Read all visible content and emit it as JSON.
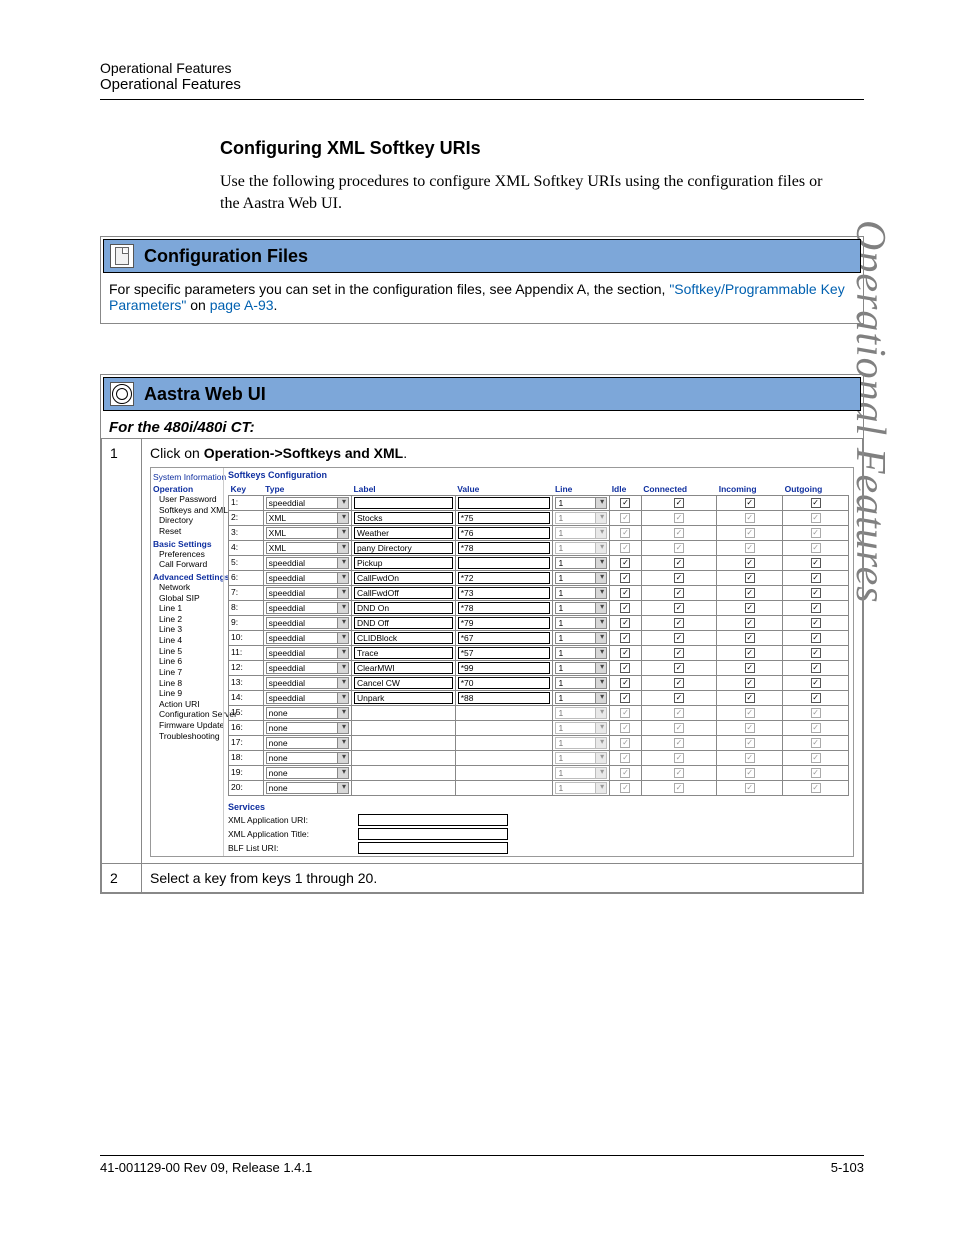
{
  "header": {
    "line1": "Operational Features",
    "line2": "Operational Features"
  },
  "vertical_tab": "Operational Features",
  "section_heading": "Configuring XML Softkey URIs",
  "intro_para": "Use the following procedures to configure XML Softkey URIs using the configuration files or the Aastra Web UI.",
  "config_panel": {
    "title": "Configuration Files",
    "body_prefix": "For specific parameters you can set in the configuration files, see Appendix A, the section, ",
    "link_text": "\"Softkey/Programmable Key Parameters\"",
    "body_mid": " on ",
    "page_ref": "page A-93",
    "body_suffix": "."
  },
  "web_panel": {
    "title": "Aastra Web UI",
    "subtitle": "For the 480i/480i CT:",
    "steps": [
      {
        "num": "1",
        "text_prefix": "Click on ",
        "text_bold": "Operation->Softkeys and XML",
        "text_suffix": "."
      },
      {
        "num": "2",
        "text": "Select a key from keys 1 through 20."
      }
    ]
  },
  "ui": {
    "nav": [
      {
        "cat": "",
        "items": [
          "System Information"
        ]
      },
      {
        "cat": "Operation",
        "items": [
          "User Password",
          "Softkeys and XML",
          "Directory",
          "Reset"
        ]
      },
      {
        "cat": "Basic Settings",
        "items": [
          "Preferences",
          "Call Forward"
        ]
      },
      {
        "cat": "Advanced Settings",
        "items": [
          "Network",
          "Global SIP",
          "Line 1",
          "Line 2",
          "Line 3",
          "Line 4",
          "Line 5",
          "Line 6",
          "Line 7",
          "Line 8",
          "Line 9",
          "Action URI",
          "Configuration Server",
          "Firmware Update",
          "Troubleshooting"
        ]
      }
    ],
    "main_title": "Softkeys Configuration",
    "columns": [
      "Key",
      "Type",
      "Label",
      "Value",
      "Line",
      "Idle",
      "Connected",
      "Incoming",
      "Outgoing"
    ],
    "rows": [
      {
        "k": "1:",
        "type": "speeddial",
        "label": "",
        "value": "",
        "line": "1",
        "dim": false
      },
      {
        "k": "2:",
        "type": "XML",
        "label": "Stocks",
        "value": "*75",
        "line": "1",
        "dim": true
      },
      {
        "k": "3:",
        "type": "XML",
        "label": "Weather",
        "value": "*76",
        "line": "1",
        "dim": true
      },
      {
        "k": "4:",
        "type": "XML",
        "label": "pany Directory",
        "value": "*78",
        "line": "1",
        "dim": true
      },
      {
        "k": "5:",
        "type": "speeddial",
        "label": "Pickup",
        "value": "",
        "line": "1",
        "dim": false
      },
      {
        "k": "6:",
        "type": "speeddial",
        "label": "CallFwdOn",
        "value": "*72",
        "line": "1",
        "dim": false
      },
      {
        "k": "7:",
        "type": "speeddial",
        "label": "CallFwdOff",
        "value": "*73",
        "line": "1",
        "dim": false
      },
      {
        "k": "8:",
        "type": "speeddial",
        "label": "DND On",
        "value": "*78",
        "line": "1",
        "dim": false
      },
      {
        "k": "9:",
        "type": "speeddial",
        "label": "DND Off",
        "value": "*79",
        "line": "1",
        "dim": false
      },
      {
        "k": "10:",
        "type": "speeddial",
        "label": "CLIDBlock",
        "value": "*67",
        "line": "1",
        "dim": false
      },
      {
        "k": "11:",
        "type": "speeddial",
        "label": "Trace",
        "value": "*57",
        "line": "1",
        "dim": false
      },
      {
        "k": "12:",
        "type": "speeddial",
        "label": "ClearMWI",
        "value": "*99",
        "line": "1",
        "dim": false
      },
      {
        "k": "13:",
        "type": "speeddial",
        "label": "Cancel CW",
        "value": "*70",
        "line": "1",
        "dim": false
      },
      {
        "k": "14:",
        "type": "speeddial",
        "label": "Unpark",
        "value": "*88",
        "line": "1",
        "dim": false
      },
      {
        "k": "15:",
        "type": "none",
        "label": "",
        "value": "",
        "line": "1",
        "dim": true
      },
      {
        "k": "16:",
        "type": "none",
        "label": "",
        "value": "",
        "line": "1",
        "dim": true
      },
      {
        "k": "17:",
        "type": "none",
        "label": "",
        "value": "",
        "line": "1",
        "dim": true
      },
      {
        "k": "18:",
        "type": "none",
        "label": "",
        "value": "",
        "line": "1",
        "dim": true
      },
      {
        "k": "19:",
        "type": "none",
        "label": "",
        "value": "",
        "line": "1",
        "dim": true
      },
      {
        "k": "20:",
        "type": "none",
        "label": "",
        "value": "",
        "line": "1",
        "dim": true
      }
    ],
    "services_title": "Services",
    "services": [
      {
        "label": "XML Application URI:",
        "value": ""
      },
      {
        "label": "XML Application Title:",
        "value": ""
      },
      {
        "label": "BLF List URI:",
        "value": ""
      }
    ]
  },
  "footer": {
    "left": "41-001129-00 Rev 09, Release 1.4.1",
    "right": "5-103"
  }
}
